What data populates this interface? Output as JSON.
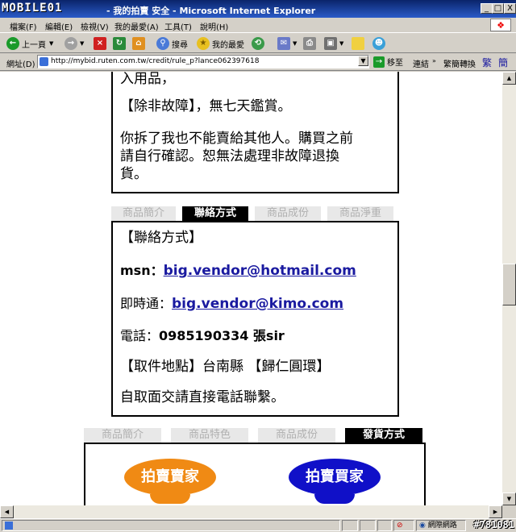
{
  "window": {
    "logo": "MOBILE01",
    "title": "- 我的拍賣 安全 - Microsoft Internet Explorer",
    "subtitle": "",
    "buttons": {
      "minimize": "_",
      "maximize": "□",
      "close": "X"
    }
  },
  "menu": [
    "檔案(F)",
    "編輯(E)",
    "檢視(V)",
    "我的最愛(A)",
    "工具(T)",
    "說明(H)"
  ],
  "toolbar": {
    "back": "上一頁",
    "search": "搜尋",
    "favorites": "我的最愛"
  },
  "address": {
    "label": "網址(D)",
    "url": "http://mybid.ruten.com.tw/credit/rule_p?lance062397618",
    "go": "移至",
    "links": "連結",
    "extra": "繁簡轉換",
    "trad": "繁",
    "simp": "簡"
  },
  "section1": {
    "line_top": "入用品，",
    "p1": "【除非故障】，無七天鑑賞。",
    "p2_line1": "你拆了我也不能賣給其他人。購買之前",
    "p2_line2": "請自行確認。恕無法處理非故障退換",
    "p2_line3": "貨。"
  },
  "tabs1": [
    {
      "label": "商品簡介",
      "active": false
    },
    {
      "label": "聯絡方式",
      "active": true
    },
    {
      "label": "商品成份",
      "active": false
    },
    {
      "label": "商品淨重",
      "active": false
    }
  ],
  "contact": {
    "heading": "【聯絡方式】",
    "msn_label": "msn：",
    "msn": "big.vendor@hotmail.com",
    "im_label": "即時通：",
    "im": "big.vendor@kimo.com",
    "phone_label": "電話：",
    "phone": "0985190334 張sir",
    "pickup": "【取件地點】台南縣 【歸仁圓環】",
    "note": "自取面交請直接電話聯繫。"
  },
  "tabs2": [
    {
      "label": "商品簡介",
      "active": false
    },
    {
      "label": "商品特色",
      "active": false
    },
    {
      "label": "商品成份",
      "active": false
    },
    {
      "label": "發貨方式",
      "active": true
    }
  ],
  "badges": {
    "seller": "拍賣賣家",
    "buyer": "拍賣買家"
  },
  "status": {
    "zone": "網際網路",
    "watermark": "#781081"
  },
  "colors": {
    "seller": "#f08a14",
    "buyer": "#1010c8",
    "link": "#1a1aa0"
  }
}
